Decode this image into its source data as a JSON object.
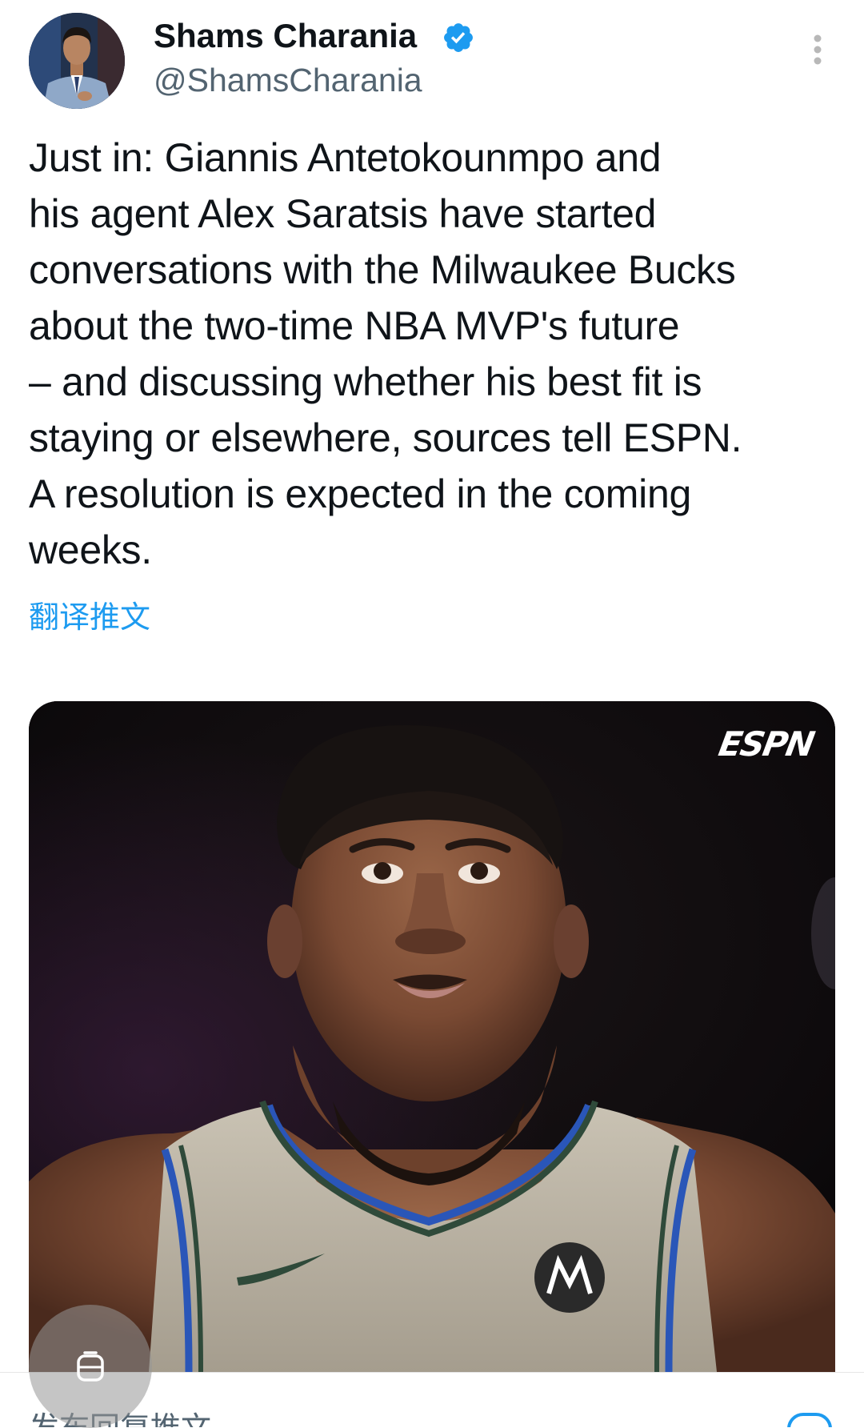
{
  "author": {
    "display_name": "Shams Charania",
    "handle": "@ShamsCharania",
    "verified": true,
    "verified_color": "#1d9bf0"
  },
  "tweet": {
    "text": "Just in: Giannis Antetokounmpo and\nhis agent Alex Saratsis have started\nconversations with the Milwaukee Bucks\nabout the two-time NBA MVP's future\n– and discussing whether his best fit is\nstaying or elsewhere, sources tell ESPN.\nA resolution is expected in the coming\nweeks.",
    "translate_label": "翻译推文"
  },
  "media": {
    "watermark": "ESPN",
    "alt_icon": "photo"
  },
  "bottom": {
    "reply_placeholder": "发布回复推文"
  },
  "colors": {
    "link": "#1d9bf0",
    "secondary_text": "#536471",
    "primary_text": "#0f1419"
  },
  "icons": {
    "verified": "verified-badge-icon",
    "more": "more-vertical-icon",
    "floating": "floating-assist-icon",
    "compose": "compose-icon"
  }
}
